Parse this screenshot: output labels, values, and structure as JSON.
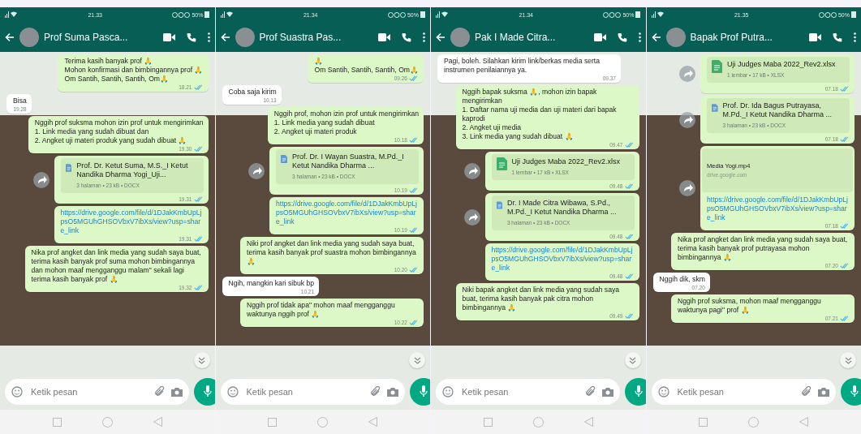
{
  "phones": [
    {
      "status_bar": {
        "time": "21.33",
        "battery": "50%"
      },
      "contact": {
        "name": "Prof Suma Pasca..."
      },
      "messages": [
        {
          "kind": "text",
          "outgoing": true,
          "read": true,
          "text": "Terima kasih banyak prof 🙏\nMohon konfirmasi dan bimbingannya prof 🙏\nOm Santih, Santih, Santih, Om🙏",
          "time": "18.21"
        },
        {
          "kind": "text",
          "outgoing": false,
          "text": "Bisa",
          "time": "19.28"
        },
        {
          "kind": "text",
          "outgoing": true,
          "read": true,
          "text": "Nggih prof suksma mohon izin prof untuk mengirimkan\n1. Link media yang sudah dibuat dan\n2. Angket uji materi produk yang sudah dibuat 🙏",
          "time": "19.30"
        },
        {
          "kind": "document",
          "outgoing": true,
          "read": true,
          "forward_button": true,
          "name": "Prof. Dr. Ketut Suma, M.S._I Ketut Nandika Dharma Yogi_Uji...",
          "meta": "3 halaman • 23 kB • DOCX",
          "time": "19.31"
        },
        {
          "kind": "link",
          "outgoing": true,
          "read": true,
          "text": "https://drive.google.com/file/d/1DJakKmbUpLjpsO5MGUhGHSOVbxV7ibXs/view?usp=share_link",
          "time": "19.31"
        },
        {
          "kind": "text",
          "outgoing": true,
          "read": true,
          "text": "Nika prof angket dan link media yang sudah saya buat, terima kasih banyak prof suma mohon bimbingannya dan mohon maaf mengganggu malam\" sekali lagi terima kasih banyak prof 🙏",
          "time": "19.32"
        }
      ],
      "composer": {
        "placeholder": "Ketik pesan"
      }
    },
    {
      "status_bar": {
        "time": "21.34",
        "battery": "50%"
      },
      "contact": {
        "name": "Prof Suastra Pas..."
      },
      "messages": [
        {
          "kind": "text",
          "outgoing": true,
          "read": true,
          "text": "🙏\nOm Santih, Santih, Santih, Om🙏",
          "time": "09.26"
        },
        {
          "kind": "text",
          "outgoing": false,
          "text": "Coba saja kirim",
          "time": "10.13"
        },
        {
          "kind": "text",
          "outgoing": true,
          "read": true,
          "text": "Nggih prof, mohon izin prof untuk mengirimkan\n1. Link media yang sudah dibuat\n2. Angket uji materi produk",
          "time": "10.18"
        },
        {
          "kind": "document",
          "outgoing": true,
          "read": true,
          "forward_button": true,
          "name": "Prof. Dr. I Wayan Suastra, M.Pd._I Ketut Nandika Dharma ...",
          "meta": "3 halaman • 23 kB • DOCX",
          "time": "10.19"
        },
        {
          "kind": "link",
          "outgoing": true,
          "read": true,
          "text": "https://drive.google.com/file/d/1DJakKmbUpLjpsO5MGUhGHSOVbxV7ibXs/view?usp=share_link",
          "time": "10.19"
        },
        {
          "kind": "text",
          "outgoing": true,
          "read": true,
          "text": "Niki prof angket dan link media yang sudah saya buat, terima kasih banyak prof suastra mohon bimbingannya 🙏",
          "time": "10.20"
        },
        {
          "kind": "text",
          "outgoing": false,
          "text": "Ngih, mangkin kari sibuk bp",
          "time": "10.21"
        },
        {
          "kind": "text",
          "outgoing": true,
          "read": true,
          "text": "Nggih prof tidak apa\" mohon maaf mengganggu waktunya nggih prof 🙏",
          "time": "10.22"
        }
      ],
      "composer": {
        "placeholder": "Ketik pesan"
      }
    },
    {
      "status_bar": {
        "time": "21.34",
        "battery": "50%"
      },
      "contact": {
        "name": "Pak I Made Citra..."
      },
      "messages": [
        {
          "kind": "text",
          "outgoing": false,
          "text": "Pagi, boleh. Silahkan kirim link/berkas media serta instrumen penilaiannya ya.",
          "time": "09.37"
        },
        {
          "kind": "text",
          "outgoing": true,
          "read": true,
          "text": "Nggih bapak suksma 🙏, mohon izin bapak mengirimkan\n1. Daftar nama uji media dan uji materi dari bapak kaprodi\n2. Angket uji media\n3. Link media yang sudah dibuat 🙏",
          "time": "09.47"
        },
        {
          "kind": "spreadsheet",
          "outgoing": true,
          "read": true,
          "forward_button": true,
          "name": "Uji Judges Maba 2022_Rev2.xlsx",
          "meta": "1 lembar • 17 kB • XLSX",
          "time": "09.48"
        },
        {
          "kind": "document",
          "outgoing": true,
          "read": true,
          "forward_button": true,
          "name": "Dr. I Made Citra Wibawa, S.Pd., M.Pd._I Ketut Nandika Dharma ...",
          "meta": "3 halaman • 23 kB • DOCX",
          "time": "09.48"
        },
        {
          "kind": "link",
          "outgoing": true,
          "read": true,
          "text": "https://drive.google.com/file/d/1DJakKmbUpLjpsO5MGUhGHSOVbxV7ibXs/view?usp=share_link",
          "time": "09.48"
        },
        {
          "kind": "text",
          "outgoing": true,
          "read": true,
          "text": "Niki bapak angket dan link media yang sudah saya buat, terima kasih banyak pak citra mohon bimbingannya 🙏",
          "time": "09.49"
        }
      ],
      "composer": {
        "placeholder": "Ketik pesan"
      }
    },
    {
      "status_bar": {
        "time": "21.35",
        "battery": "50%"
      },
      "contact": {
        "name": "Bapak Prof Putra..."
      },
      "messages": [
        {
          "kind": "spreadsheet",
          "outgoing": true,
          "read": true,
          "forward_button": true,
          "name": "Uji Judges Maba 2022_Rev2.xlsx",
          "meta": "1 lembar • 17 kB • XLSX",
          "time": "07.18"
        },
        {
          "kind": "document",
          "outgoing": true,
          "read": true,
          "forward_button": true,
          "name": "Prof. Dr. Ida Bagus Putrayasa, M.Pd._I Ketut Nandika Dharma ...",
          "meta": "3 halaman • 23 kB • DOCX",
          "time": "07.18"
        },
        {
          "kind": "link_preview",
          "outgoing": true,
          "read": true,
          "forward_button": true,
          "title": "Media Yogi.mp4",
          "domain": "drive.google.com",
          "text": "https://drive.google.com/file/d/1DJakKmbUpLjpsO5MGUhGHSOVbxV7ibXs/view?usp=share_link",
          "time": "07.18"
        },
        {
          "kind": "text",
          "outgoing": true,
          "read": true,
          "text": "Nika prof angket dan link media yang sudah saya buat, terima kasih banyak prof putrayasa mohon bimbingannya 🙏",
          "time": "07.20"
        },
        {
          "kind": "text",
          "outgoing": false,
          "text": "Nggih dik, skm",
          "time": "07.20"
        },
        {
          "kind": "text",
          "outgoing": true,
          "read": true,
          "text": "Nggih prof suksma, mohon maaf mengganggu waktunya pagi\" prof 🙏",
          "time": "07.21"
        }
      ],
      "composer": {
        "placeholder": "Ketik pesan"
      }
    }
  ]
}
